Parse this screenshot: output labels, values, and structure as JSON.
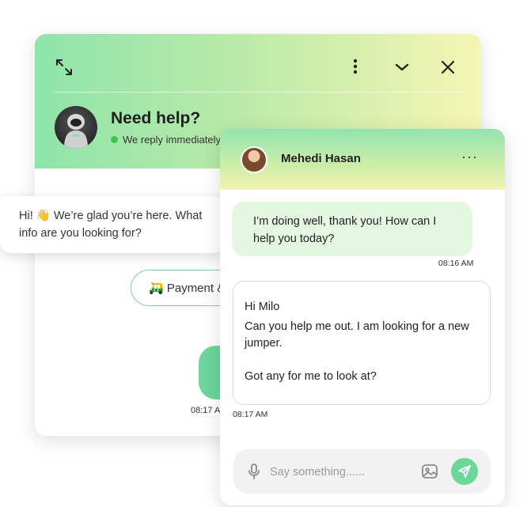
{
  "widget": {
    "title": "Need help?",
    "status": "We reply immediately",
    "greeting": "Hi! 👋 We’re glad you’re here. What info are you looking for?",
    "quick_reply": "🛺 Payment & ...",
    "time": "08:17 AM",
    "icons": [
      "expand-icon",
      "more-vertical-icon",
      "chevron-down-icon",
      "close-icon"
    ]
  },
  "chat": {
    "agent_name": "Mehedi Hasan",
    "menu_glyph": "···",
    "messages": [
      {
        "from": "agent",
        "text": "I’m doing well, thank you! How can I help you today?",
        "time": "08:16 AM"
      },
      {
        "from": "user",
        "lines": [
          "Hi Milo",
          "Can you help me out. I am looking for a new jumper.",
          "Got any for me to look at?"
        ],
        "time": "08:17 AM"
      }
    ],
    "input_placeholder": "Say something......",
    "icons": [
      "microphone-icon",
      "image-icon",
      "send-icon"
    ]
  },
  "colors": {
    "accent": "#6cd79a",
    "header_gradient_start": "#8fe4ab",
    "header_gradient_end": "#f6f5b4",
    "agent_bubble": "#e4f7e1",
    "online": "#3cc24f"
  }
}
